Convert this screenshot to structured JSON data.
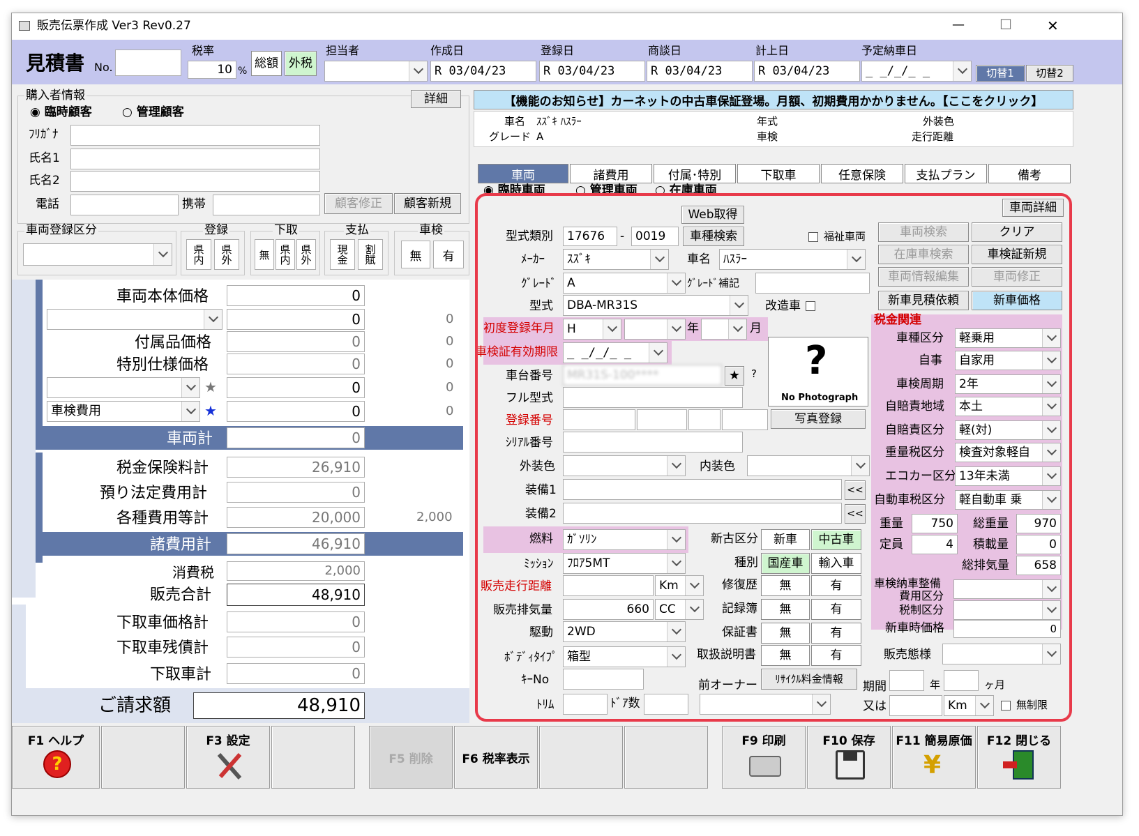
{
  "window": {
    "title": "販売伝票作成 Ver3 Rev0.27",
    "minimize": "—",
    "maximize": "☐",
    "close": "✕"
  },
  "header": {
    "doc_type": "見積書",
    "no_label": "No.",
    "tax_rate_label": "税率",
    "tax_rate": "10",
    "percent": "%",
    "total_btn": "総額",
    "excl_btn": "外税",
    "staff_label": "担当者",
    "created_label": "作成日",
    "created": "R 03/04/23",
    "registered_label": "登録日",
    "registered": "R 03/04/23",
    "negotiation_label": "商談日",
    "negotiation": "R 03/04/23",
    "booking_label": "計上日",
    "booking": "R 03/04/23",
    "delivery_label": "予定納車日",
    "delivery": "_ _/_/_ _",
    "switch1": "切替1",
    "switch2": "切替2"
  },
  "buyer": {
    "group_label": "購入者情報",
    "detail_btn": "詳細",
    "radio_temp": "臨時顧客",
    "radio_managed": "管理顧客",
    "furigana": "ﾌﾘｶﾞﾅ",
    "name1": "氏名1",
    "name2": "氏名2",
    "phone": "電話",
    "mobile": "携帯",
    "edit_btn": "顧客修正",
    "new_btn": "顧客新規"
  },
  "reg": {
    "category_label": "車両登録区分",
    "reg_label": "登録",
    "reg_opts": [
      "県内",
      "県外"
    ],
    "trade_label": "下取",
    "trade_opts": [
      "無",
      "県内",
      "県外"
    ],
    "pay_label": "支払",
    "pay_opts": [
      "現金",
      "割賦"
    ],
    "inspect_label": "車検",
    "inspect_opts": [
      "無",
      "有"
    ]
  },
  "price": {
    "body_label": "車両本体価格",
    "body": "0",
    "row2": "0",
    "row2b": "0",
    "acc_label": "付属品価格",
    "acc": "0",
    "acc_b": "0",
    "spec_label": "特別仕様価格",
    "spec": "0",
    "spec_b": "0",
    "row5": "0",
    "row5b": "0",
    "star": "★",
    "inspect_fee_label": "車検費用",
    "row6": "0",
    "row6b": "0",
    "vehicle_total_label": "車両計",
    "vehicle_total": "0",
    "tax_ins_label": "税金保険料計",
    "tax_ins": "26,910",
    "legal_label": "預り法定費用計",
    "legal": "0",
    "fees_label": "各種費用等計",
    "fees": "20,000",
    "fees_b": "2,000",
    "misc_total_label": "諸費用計",
    "misc_total": "46,910",
    "ctax_label": "消費税",
    "ctax": "2,000",
    "sales_total_label": "販売合計",
    "sales_total": "48,910",
    "tradein_label": "下取車価格計",
    "tradein": "0",
    "tradein_rem_label": "下取車残債計",
    "tradein_rem": "0",
    "tradein_total_label": "下取車計",
    "tradein_total": "0",
    "invoice_label": "ご請求額",
    "invoice": "48,910"
  },
  "notice": "【機能のお知らせ】カーネットの中古車保証登場。月額、初期費用かかりません。【ここをクリック】",
  "summary": {
    "car_name_label": "車名",
    "car_name": "ｽｽﾞｷ ﾊｽﾗｰ",
    "grade_label": "グレード",
    "grade": "A",
    "year_label": "年式",
    "inspect_label": "車検",
    "color_label": "外装色",
    "mileage_label": "走行距離"
  },
  "tabs": [
    "車両",
    "諸費用",
    "付属･特別",
    "下取車",
    "任意保険",
    "支払プラン",
    "備考"
  ],
  "vehicle": {
    "radio_temp": "臨時車両",
    "radio_managed": "管理車両",
    "radio_stock": "在庫車両",
    "detail_btn": "車両詳細",
    "web_btn": "Web取得",
    "model_no_label": "型式類別",
    "model_no1": "17676",
    "dash": "-",
    "model_no2": "0019",
    "type_search_btn": "車種検索",
    "welfare_label": "福祉車両",
    "maker_label": "ﾒｰｶｰ",
    "maker": "ｽｽﾞｷ",
    "car_label": "車名",
    "car": "ﾊｽﾗｰ",
    "grade_label": "ｸﾞﾚｰﾄﾞ",
    "grade": "A",
    "grade_sup_label": "ｸﾞﾚｰﾄﾞ補記",
    "model_label": "型式",
    "model": "DBA-MR31S",
    "modified_label": "改造車",
    "first_reg_label": "初度登録年月",
    "era": "H",
    "year_unit": "年",
    "month_unit": "月",
    "expiry_label": "車検証有効期限",
    "expiry": "_ _/_/_ _",
    "chassis_label": "車台番号",
    "chassis": "MR31S-100****",
    "qmark": "?",
    "full_model_label": "フル型式",
    "reg_no_label": "登録番号",
    "serial_label": "ｼﾘｱﾙ番号",
    "ext_color_label": "外装色",
    "int_color_label": "内装色",
    "equip1_label": "装備1",
    "equip2_label": "装備2",
    "back_btn": "<<",
    "fuel_label": "燃料",
    "fuel": "ｶﾞｿﾘﾝ",
    "mission_label": "ﾐｯｼｮﾝ",
    "mission": "ﾌﾛｱ5MT",
    "mileage_label": "販売走行距離",
    "km": "Km",
    "disp_label": "販売排気量",
    "disp": "660",
    "cc": "CC",
    "drive_label": "駆動",
    "drive": "2WD",
    "body_label": "ﾎﾞﾃﾞｨﾀｲﾌﾟ",
    "body": "箱型",
    "key_label": "ｷｰNo",
    "trim_label": "ﾄﾘﾑ",
    "door_label": "ﾄﾞｱ数",
    "new_used_label": "新古区分",
    "new_btn": "新車",
    "used_btn": "中古車",
    "kind_label": "種別",
    "domestic_btn": "国産車",
    "import_btn": "輸入車",
    "repair_label": "修復歴",
    "book_label": "記録簿",
    "warranty_label": "保証書",
    "manual_label": "取扱説明書",
    "no": "無",
    "yes": "有",
    "prev_owner_label": "前オーナー",
    "recycle_btn": "ﾘｻｲｸﾙ料金情報",
    "period_label": "期間",
    "year": "年",
    "month": "ヶ月",
    "or_label": "又は",
    "unlimited_label": "無制限",
    "photo_q": "?",
    "no_photo": "No Photograph",
    "photo_btn": "写真登録"
  },
  "actions": {
    "vehicle_search": "車両検索",
    "clear": "クリア",
    "stock_search": "在庫車検索",
    "cert_new": "車検証新規",
    "info_edit": "車両情報編集",
    "vehicle_edit": "車両修正",
    "new_estimate": "新車見積依頼",
    "new_price": "新車価格"
  },
  "tax": {
    "group_label": "税金関連",
    "car_type_label": "車種区分",
    "car_type": "軽乗用",
    "use_label": "自事",
    "use": "自家用",
    "cycle_label": "車検周期",
    "cycle": "2年",
    "region_label": "自賠責地域",
    "region": "本土",
    "cmi_label": "自賠責区分",
    "cmi": "軽(対)",
    "weight_tax_label": "重量税区分",
    "weight_tax": "検査対象軽自",
    "eco_label": "エコカー区分",
    "eco": "13年未満",
    "auto_tax_label": "自動車税区分",
    "auto_tax": "軽自動車 乗",
    "weight_label": "重量",
    "weight": "750",
    "gross_label": "総重量",
    "gross": "970",
    "capacity_label": "定員",
    "capacity": "4",
    "load_label": "積載量",
    "load": "0",
    "displacement_label": "総排気量",
    "displacement": "658",
    "maint_label_1": "車検納車整備",
    "maint_label_2": "費用区分",
    "tax_div_label": "税制区分",
    "new_price_label": "新車時価格",
    "new_price": "0",
    "sale_mode_label": "販売態様"
  },
  "fkeys": [
    "F1 ヘルプ",
    "F3 設定",
    "F5 削除",
    "F6 税率表示",
    "F9 印刷",
    "F10 保存",
    "F11 簡易原価",
    "F12 閉じる"
  ],
  "colors": {
    "header_band": "#c4c6ee",
    "accent_red": "#e83a4a",
    "total_bar": "#6078a8",
    "pink": "#e8c2e2",
    "green": "#cff5cf"
  }
}
